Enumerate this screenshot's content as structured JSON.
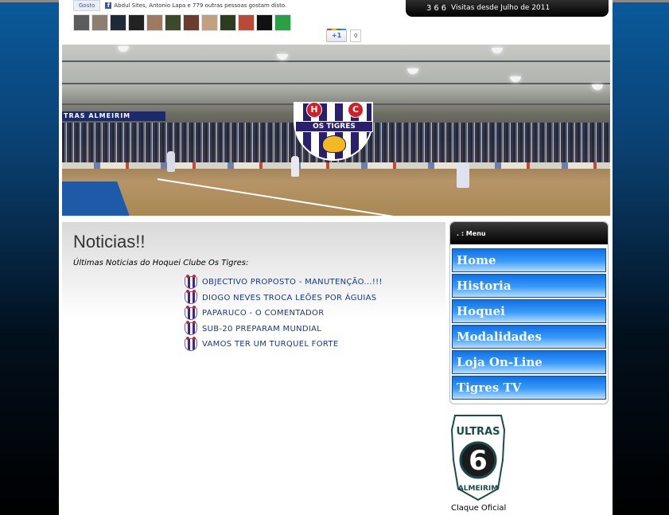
{
  "facebook": {
    "like_label": "Gosto",
    "social_text": "Abdul Sites, Antonio Lapa e 779 outras pessoas gostam disto."
  },
  "faces": [
    {
      "name": "face-1",
      "color": "#5c5c5c"
    },
    {
      "name": "face-2",
      "color": "#8a7f70"
    },
    {
      "name": "face-3",
      "color": "#1e2a3a"
    },
    {
      "name": "face-4",
      "color": "#222222"
    },
    {
      "name": "face-5",
      "color": "#a07a60"
    },
    {
      "name": "face-6",
      "color": "#3b4a2a"
    },
    {
      "name": "face-7",
      "color": "#6b3b2b"
    },
    {
      "name": "face-8",
      "color": "#c0a080"
    },
    {
      "name": "face-9",
      "color": "#2a3d1e"
    },
    {
      "name": "face-10",
      "color": "#b84a3a"
    },
    {
      "name": "face-11",
      "color": "#111111"
    },
    {
      "name": "face-12",
      "color": "#2aa046"
    }
  ],
  "gplus": {
    "button_label": "+1",
    "count": "0"
  },
  "visits": {
    "count": "366",
    "label": "Visitas desde Julho de 2011"
  },
  "banner": {
    "crowd_sign": "TRAS ALMEIRIM",
    "logo_h": "H",
    "logo_c": "C",
    "logo_ribbon": "OS TIGRES"
  },
  "main": {
    "title": "Noticias!!",
    "subtitle": "Últimas Noticias do Hoquei Clube Os Tigres:",
    "news": [
      "OBJECTIVO PROPOSTO - MANUTENÇÃO...!!!",
      "DIOGO NEVES TROCA LEÕES POR ÁGUIAS",
      "PAPARUCO - O COMENTADOR",
      "SUB-20 PREPARAM MUNDIAL",
      "VAMOS TER UM TURQUEL FORTE"
    ]
  },
  "menu": {
    "header": ". : Menu",
    "items": [
      "Home",
      "Historia",
      "Hoquei",
      "Modalidades",
      "Loja On-Line",
      "Tigres TV"
    ]
  },
  "sidebar": {
    "ultras_top": "ULTRAS",
    "ultras_number": "6",
    "ultras_bottom": "ALMEIRIM",
    "caption": "Claque Oficial"
  },
  "colors": {
    "menu_blue": "#0f71e6",
    "news_link": "#1a3a7a",
    "page_bg_top": "#0a5a9c"
  }
}
